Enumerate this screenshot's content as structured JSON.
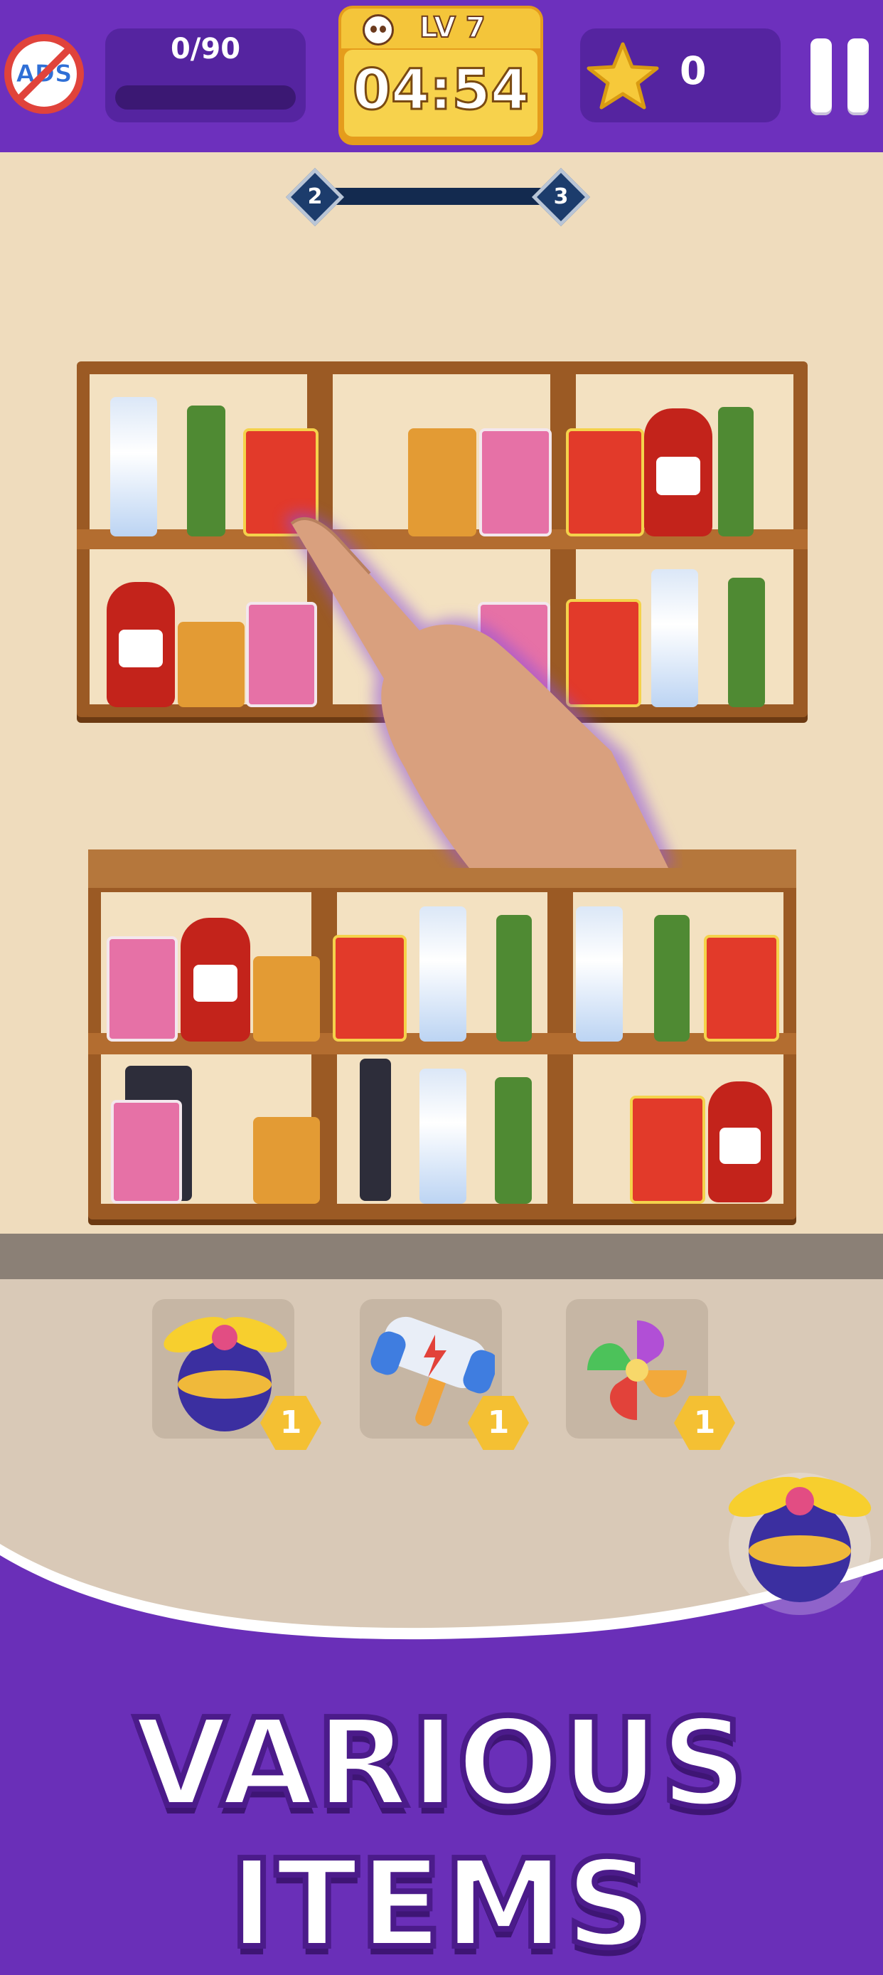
{
  "hud": {
    "ads_label": "ADS",
    "progress_text": "0/90",
    "progress_fraction": 0,
    "level_label": "LV 7",
    "timer": "04:54",
    "stars": "0"
  },
  "stage": {
    "from": "2",
    "to": "3"
  },
  "boosters": [
    {
      "name": "propeller",
      "count": "1"
    },
    {
      "name": "hammer",
      "count": "1"
    },
    {
      "name": "pinwheel",
      "count": "1"
    }
  ],
  "title": "VARIOUS ITEMS",
  "colors": {
    "accent": "#6d30bd",
    "timer": "#f4c53a",
    "wood": "#9b5a24"
  }
}
